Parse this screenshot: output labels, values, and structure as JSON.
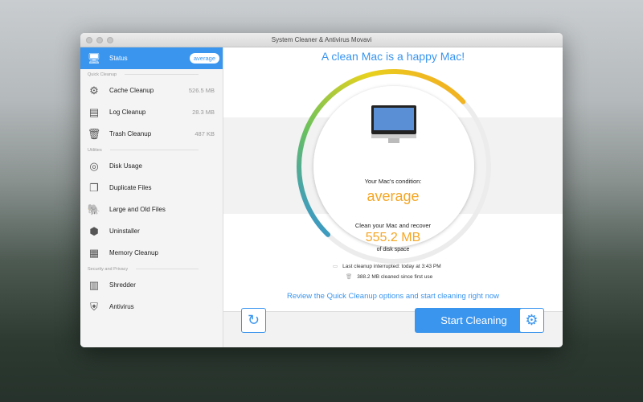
{
  "window": {
    "title": "System Cleaner & Antivirus Movavi"
  },
  "sidebar": {
    "status": {
      "label": "Status",
      "badge": "average"
    },
    "sections": [
      {
        "title": "Quick Cleanup",
        "items": [
          {
            "label": "Cache Cleanup",
            "size": "526.5 MB"
          },
          {
            "label": "Log Cleanup",
            "size": "28.3 MB"
          },
          {
            "label": "Trash Cleanup",
            "size": "487 KB"
          }
        ]
      },
      {
        "title": "Utilities",
        "items": [
          {
            "label": "Disk Usage"
          },
          {
            "label": "Duplicate Files"
          },
          {
            "label": "Large and Old Files"
          },
          {
            "label": "Uninstaller"
          },
          {
            "label": "Memory Cleanup"
          }
        ]
      },
      {
        "title": "Security and Privacy",
        "items": [
          {
            "label": "Shredder"
          },
          {
            "label": "Antivirus"
          }
        ]
      }
    ]
  },
  "main": {
    "headline": "A clean Mac is a happy Mac!",
    "condition_label": "Your Mac's condition:",
    "condition_value": "average",
    "recover_label": "Clean your Mac and recover",
    "recover_amount": "555.2 MB",
    "recover_suffix": "of disk space",
    "last_cleanup": "Last cleanup interrupted: today at 3:43 PM",
    "cleaned_total": "388.2 MB cleaned since first use",
    "hint": "Review the Quick Cleanup options and start cleaning right now",
    "start_button": "Start Cleaning",
    "gauge_fraction": 0.5
  },
  "colors": {
    "accent": "#3a95ee",
    "warning": "#f5a623"
  }
}
